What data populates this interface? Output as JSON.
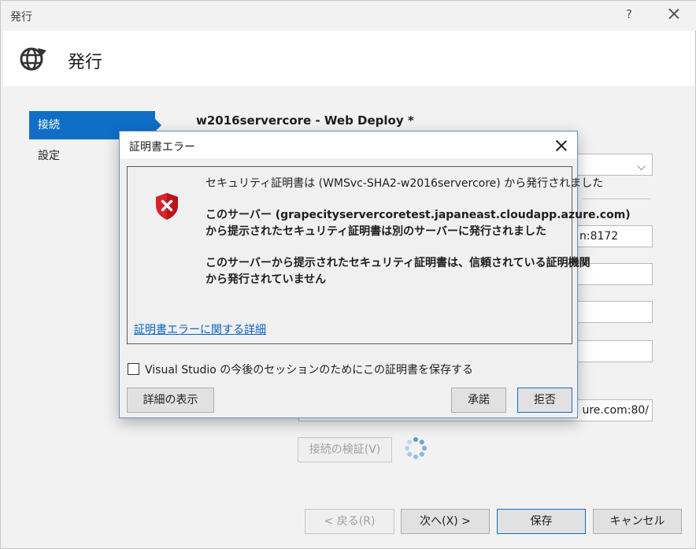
{
  "window": {
    "title": "発行",
    "help": "?"
  },
  "header": {
    "title": "発行"
  },
  "nav": {
    "items": [
      {
        "label": "接続"
      },
      {
        "label": "設定"
      }
    ]
  },
  "profile": {
    "title": "w2016servercore - Web Deploy *"
  },
  "fields": {
    "server_suffix": "n:8172",
    "url_suffix": "ure.com:80/"
  },
  "buttons": {
    "validate": "接続の検証(V)",
    "back": "< 戻る(R)",
    "next": "次へ(X) >",
    "save": "保存",
    "cancel": "キャンセル"
  },
  "modal": {
    "title": "証明書エラー",
    "messages": [
      "セキュリティ証明書は (WMSvc-SHA2-w2016servercore) から発行されました",
      "このサーバー (grapecityservercoretest.japaneast.cloudapp.azure.com)",
      "から提示されたセキュリティ証明書は別のサーバーに発行されました",
      "このサーバーから提示されたセキュリティ証明書は、信頼されている証明機関",
      "から発行されていません"
    ],
    "details_link": "証明書エラーに関する詳細",
    "save_checkbox_label": "Visual Studio の今後のセッションのためにこの証明書を保存する",
    "save_checkbox_checked": false,
    "show_details_button": "詳細の表示",
    "accept_button": "承諾",
    "reject_button": "拒否"
  },
  "colors": {
    "accent": "#0f6fc6",
    "link": "#0b64c0",
    "error": "#d9222a"
  }
}
